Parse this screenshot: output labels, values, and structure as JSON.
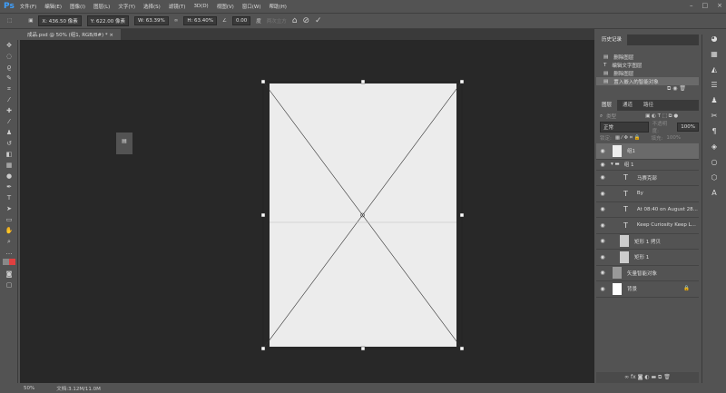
{
  "app": {
    "logo": "Ps"
  },
  "menu": [
    "文件(F)",
    "编辑(E)",
    "图像(I)",
    "图层(L)",
    "文字(Y)",
    "选择(S)",
    "滤镜(T)",
    "3D(D)",
    "视图(V)",
    "窗口(W)",
    "帮助(H)"
  ],
  "window_controls": {
    "minimize": "–",
    "maximize": "□",
    "close": "×"
  },
  "options": {
    "x": "X: 436.50 像素",
    "y": "Y: 622.00 像素",
    "w": "W: 63.39%",
    "h": "H: 63.40%",
    "angle": "0.00",
    "angle_unit": "度",
    "interp": "两次立方",
    "cancel": "⊘",
    "commit": "✓",
    "warp": "⌂"
  },
  "document_tab": "成品.psd @ 50% (组1, RGB/8#) * ×",
  "status": {
    "zoom": "50%",
    "doc": "文档:3.12M/11.0M"
  },
  "history": {
    "title": "历史记录",
    "items": [
      {
        "label": "删除图层",
        "icon": "doc"
      },
      {
        "label": "编辑文字图层",
        "icon": "T"
      },
      {
        "label": "删除图层",
        "icon": "doc"
      },
      {
        "label": "置入嵌入的智能对象",
        "icon": "doc",
        "selected": true
      }
    ]
  },
  "layers": {
    "tabs": [
      "图层",
      "通道",
      "路径"
    ],
    "filter": "类型",
    "blend": "正常",
    "opacity_label": "不透明度:",
    "opacity": "100%",
    "lock_label": "锁定:",
    "fill_label": "填充:",
    "fill": "100%",
    "items": [
      {
        "name": "组1",
        "type": "smart",
        "selected": true
      },
      {
        "name": "组 1",
        "type": "group"
      },
      {
        "name": "马赛克部",
        "type": "text"
      },
      {
        "name": "By",
        "type": "text"
      },
      {
        "name": "At 08:40 on August 28...",
        "type": "text"
      },
      {
        "name": "Keep Curiosity Keep L...",
        "type": "text"
      },
      {
        "name": "矩形 1 拷贝",
        "type": "shape"
      },
      {
        "name": "矩形 1",
        "type": "shape"
      },
      {
        "name": "矢量智能对象",
        "type": "smart"
      },
      {
        "name": "背景",
        "type": "bg",
        "locked": true
      }
    ]
  }
}
